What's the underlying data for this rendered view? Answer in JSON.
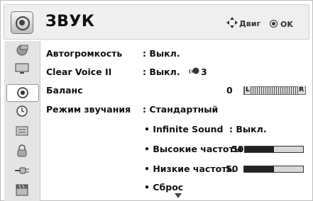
{
  "header": {
    "title": "ЗВУК",
    "nav_label": "Двиг",
    "ok_label": "OK"
  },
  "sidebar": {
    "items": [
      {
        "icon": "picture-icon"
      },
      {
        "icon": "screen-icon"
      },
      {
        "icon": "sound-icon",
        "active": true
      },
      {
        "icon": "time-icon"
      },
      {
        "icon": "options-icon"
      },
      {
        "icon": "lock-icon"
      },
      {
        "icon": "input-icon"
      },
      {
        "icon": "usb-icon"
      }
    ]
  },
  "menu": {
    "auto_volume": {
      "label": "Автогромкость",
      "value": ": Выкл."
    },
    "clear_voice": {
      "label": "Clear Voice II",
      "value": ": Выкл.",
      "level": "3"
    },
    "balance": {
      "label": "Баланс",
      "value": "0",
      "left": "L",
      "right": "R"
    },
    "sound_mode": {
      "label": "Режим звучания",
      "value": ": Стандартный"
    },
    "infinite_sound": {
      "label": "• Infinite Sound",
      "value": ": Выкл."
    },
    "treble": {
      "label": "• Высокие частоты",
      "value": "50",
      "level": 0.5
    },
    "bass": {
      "label": "• Низкие частоты",
      "value": "50",
      "level": 0.5
    },
    "reset": {
      "label": "• Сброс"
    }
  },
  "colors": {
    "bar_fill": "#222222",
    "header_bg": "#efefef"
  }
}
